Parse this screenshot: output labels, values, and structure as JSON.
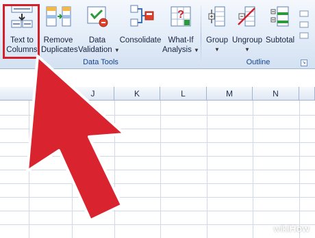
{
  "ribbon": {
    "data_tools": {
      "label": "Data Tools",
      "text_to_columns": {
        "line1": "Text to",
        "line2": "Columns",
        "icon": "text-to-columns-icon"
      },
      "remove_duplicates": {
        "line1": "Remove",
        "line2": "Duplicates",
        "icon": "remove-duplicates-icon"
      },
      "data_validation": {
        "line1": "Data",
        "line2": "Validation",
        "icon": "data-validation-icon"
      },
      "consolidate": {
        "line1": "Consolidate",
        "icon": "consolidate-icon"
      },
      "what_if": {
        "line1": "What-If",
        "line2": "Analysis",
        "icon": "what-if-analysis-icon"
      }
    },
    "outline": {
      "label": "Outline",
      "group": {
        "line1": "Group",
        "icon": "group-icon"
      },
      "ungroup": {
        "line1": "Ungroup",
        "icon": "ungroup-icon"
      },
      "subtotal": {
        "line1": "Subtotal",
        "icon": "subtotal-icon"
      }
    },
    "highlight_color": "#d41f2b"
  },
  "sheet": {
    "columns": [
      "J",
      "K",
      "L",
      "M",
      "N"
    ]
  },
  "overlay": {
    "pointer": "red-arrow-pointer",
    "pointer_color": "#d9232e"
  },
  "watermark": {
    "wiki": "wiki",
    "how": "How"
  }
}
